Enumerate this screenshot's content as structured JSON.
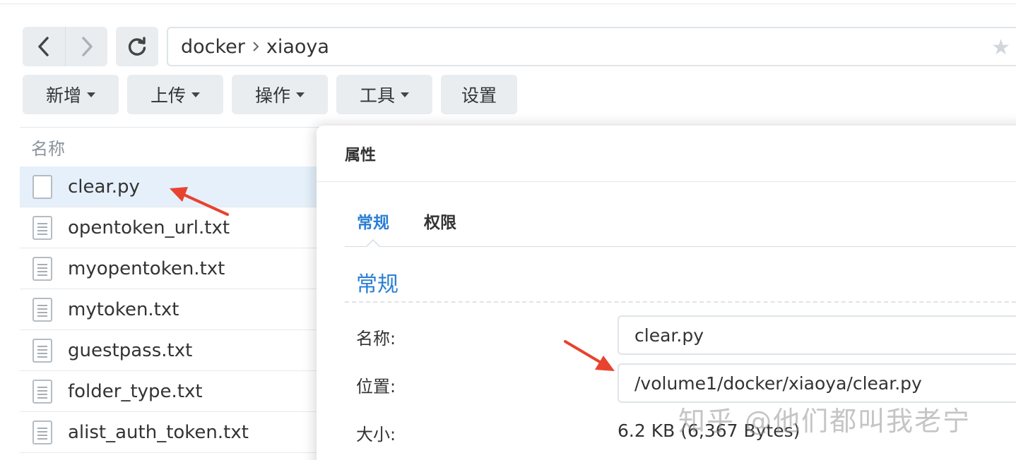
{
  "nav": {
    "back_icon": "chevron-left-icon",
    "forward_icon": "chevron-right-icon",
    "refresh_icon": "refresh-icon"
  },
  "address_bar": {
    "crumbs": [
      "docker",
      "xiaoya"
    ],
    "bookmark_icon": "star-icon"
  },
  "toolbar": {
    "new_label": "新增",
    "upload_label": "上传",
    "action_label": "操作",
    "tools_label": "工具",
    "settings_label": "设置"
  },
  "file_list": {
    "header_name": "名称",
    "files": [
      {
        "name": "clear.py",
        "selected": true
      },
      {
        "name": "opentoken_url.txt",
        "selected": false
      },
      {
        "name": "myopentoken.txt",
        "selected": false
      },
      {
        "name": "mytoken.txt",
        "selected": false
      },
      {
        "name": "guestpass.txt",
        "selected": false
      },
      {
        "name": "folder_type.txt",
        "selected": false
      },
      {
        "name": "alist_auth_token.txt",
        "selected": false
      }
    ]
  },
  "dialog": {
    "title": "属性",
    "tabs": [
      {
        "label": "常规",
        "active": true
      },
      {
        "label": "权限",
        "active": false
      }
    ],
    "section_title": "常规",
    "name_label": "名称:",
    "name_value": "clear.py",
    "location_label": "位置:",
    "location_value": "/volume1/docker/xiaoya/clear.py",
    "size_label": "大小:",
    "size_value": "6.2 KB (6,367 Bytes)"
  },
  "watermark": "知乎 @他们都叫我老宁",
  "colors": {
    "accent": "#2a7fd3",
    "button_bg": "#e9edf0",
    "selected_row": "#e5f0fb",
    "arrow": "#e8432e"
  }
}
